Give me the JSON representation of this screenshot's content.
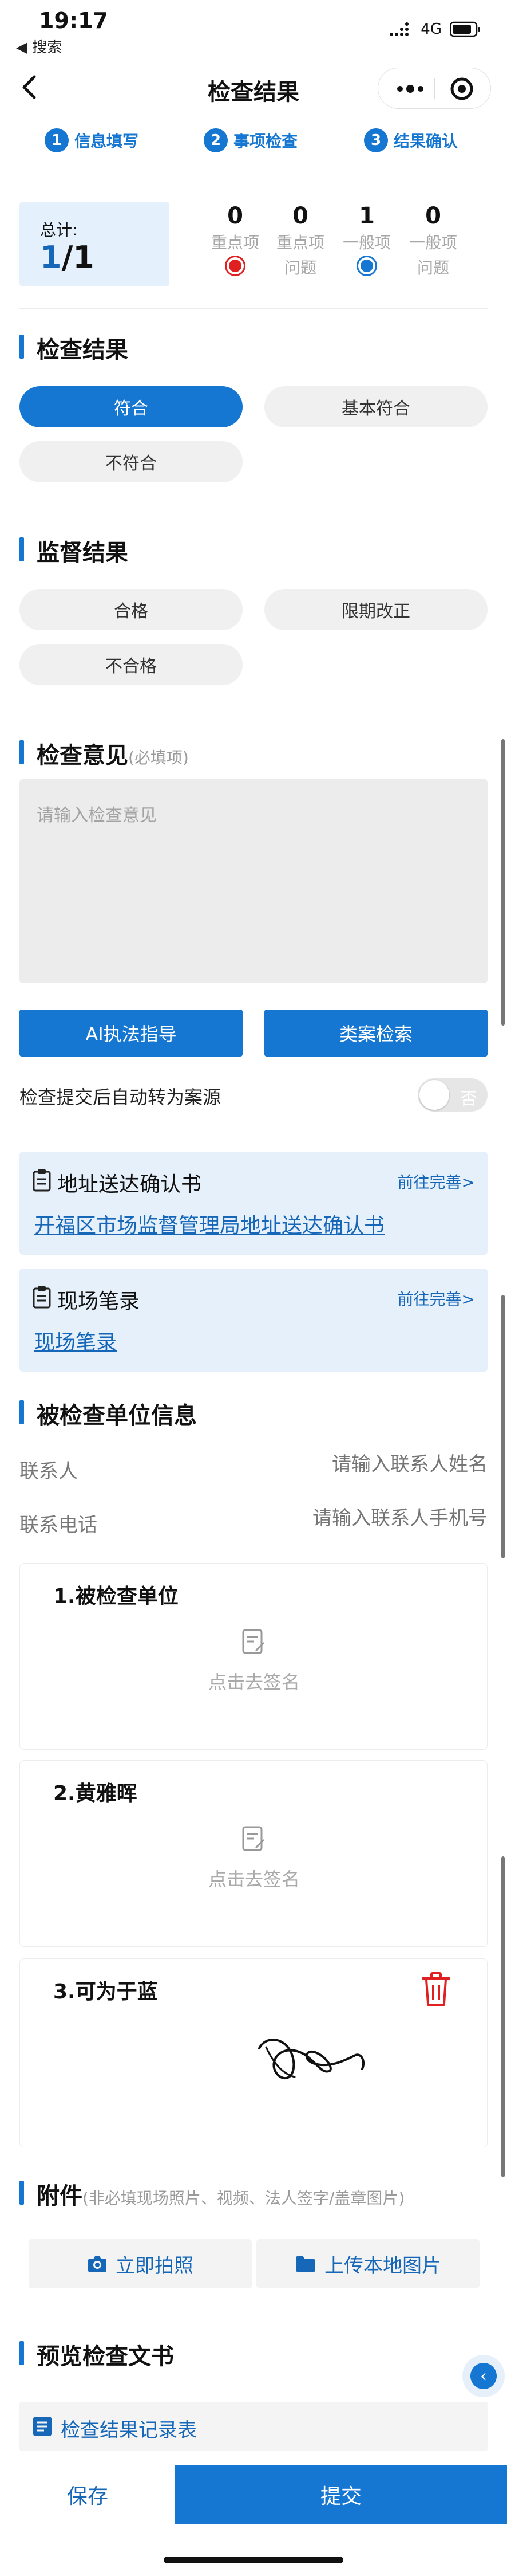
{
  "status_bar": {
    "time": "19:17",
    "back_app": "◀ 搜索",
    "network": "4G"
  },
  "nav": {
    "title": "检查结果"
  },
  "steps": [
    {
      "num": "1",
      "label": "信息填写"
    },
    {
      "num": "2",
      "label": "事项检查"
    },
    {
      "num": "3",
      "label": "结果确认"
    }
  ],
  "summary": {
    "label": "总计:",
    "current": "1",
    "total": "/1",
    "stats": [
      {
        "value": "0",
        "label": "重点项",
        "dot": "red"
      },
      {
        "value": "0",
        "label": "重点项问题",
        "dot": null
      },
      {
        "value": "1",
        "label": "一般项",
        "dot": "blue"
      },
      {
        "value": "0",
        "label": "一般项问题",
        "dot": null
      }
    ]
  },
  "inspection_result": {
    "title": "检查结果",
    "options": [
      "符合",
      "基本符合",
      "不符合"
    ],
    "selected": "符合"
  },
  "supervision_result": {
    "title": "监督结果",
    "options": [
      "合格",
      "限期改正",
      "不合格"
    ]
  },
  "opinion": {
    "title": "检查意见",
    "hint": "(必填项)",
    "placeholder": "请输入检查意见"
  },
  "buttons": {
    "ai_guide": "AI执法指导",
    "case_search": "类案检索"
  },
  "auto_case": {
    "label": "检查提交后自动转为案源",
    "toggle_text": "否"
  },
  "docs": [
    {
      "title": "地址送达确认书",
      "action": "前往完善>",
      "link": "开福区市场监督管理局地址送达确认书"
    },
    {
      "title": "现场笔录",
      "action": "前往完善>",
      "link": "现场笔录"
    }
  ],
  "unit_info": {
    "title": "被检查单位信息",
    "contact_label": "联系人",
    "contact_placeholder": "请输入联系人姓名",
    "phone_label": "联系电话",
    "phone_placeholder": "请输入联系人手机号"
  },
  "signatures": [
    {
      "title": "1.被检查单位",
      "action": "点击去签名"
    },
    {
      "title": "2.黄雅晖",
      "action": "点击去签名"
    },
    {
      "title": "3.可为于蓝"
    }
  ],
  "attachments": {
    "title": "附件",
    "hint": "(非必填现场照片、视频、法人签字/盖章图片)",
    "take_photo": "立即拍照",
    "upload": "上传本地图片"
  },
  "preview": {
    "title": "预览检查文书",
    "item": "检查结果记录表"
  },
  "footer": {
    "save": "保存",
    "submit": "提交"
  },
  "colors": {
    "primary": "#1677d2",
    "danger": "#e02020",
    "card_bg": "#e6f0fb"
  }
}
